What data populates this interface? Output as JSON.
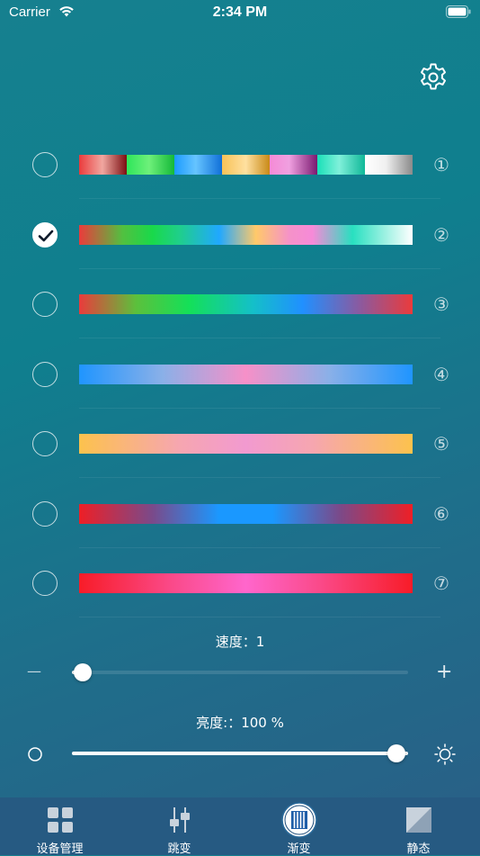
{
  "status_bar": {
    "carrier": "Carrier",
    "time": "2:34 PM"
  },
  "settings": {
    "icon": "gear-icon"
  },
  "modes": [
    {
      "number": "①",
      "selected": false
    },
    {
      "number": "②",
      "selected": true
    },
    {
      "number": "③",
      "selected": false
    },
    {
      "number": "④",
      "selected": false
    },
    {
      "number": "⑤",
      "selected": false
    },
    {
      "number": "⑥",
      "selected": false
    },
    {
      "number": "⑦",
      "selected": false
    }
  ],
  "speed": {
    "label": "速度：1",
    "value": 1,
    "fraction": 0.03,
    "minus": "—",
    "plus": "+"
  },
  "brightness": {
    "label": "亮度:：100 %",
    "value_percent": 100
  },
  "tabs": [
    {
      "label": "设备管理",
      "icon": "grid-icon",
      "active": false
    },
    {
      "label": "跳变",
      "icon": "sliders-icon",
      "active": false
    },
    {
      "label": "渐变",
      "icon": "gradient-icon",
      "active": true
    },
    {
      "label": "静态",
      "icon": "static-icon",
      "active": false
    }
  ],
  "colors": {
    "tab_bar": "#265a82",
    "accent": "#ffffff"
  }
}
